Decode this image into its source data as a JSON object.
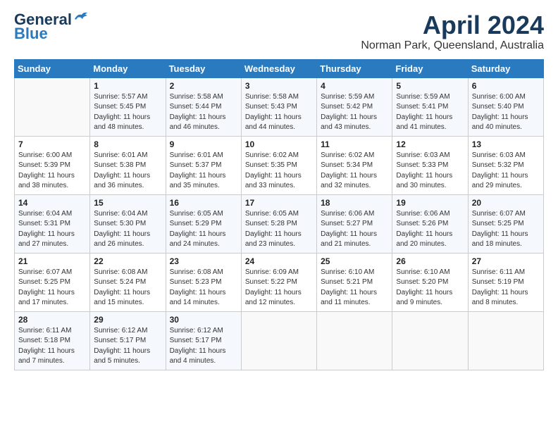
{
  "logo": {
    "line1": "General",
    "line2": "Blue"
  },
  "title": "April 2024",
  "location": "Norman Park, Queensland, Australia",
  "headers": [
    "Sunday",
    "Monday",
    "Tuesday",
    "Wednesday",
    "Thursday",
    "Friday",
    "Saturday"
  ],
  "weeks": [
    [
      {
        "day": "",
        "info": ""
      },
      {
        "day": "1",
        "info": "Sunrise: 5:57 AM\nSunset: 5:45 PM\nDaylight: 11 hours\nand 48 minutes."
      },
      {
        "day": "2",
        "info": "Sunrise: 5:58 AM\nSunset: 5:44 PM\nDaylight: 11 hours\nand 46 minutes."
      },
      {
        "day": "3",
        "info": "Sunrise: 5:58 AM\nSunset: 5:43 PM\nDaylight: 11 hours\nand 44 minutes."
      },
      {
        "day": "4",
        "info": "Sunrise: 5:59 AM\nSunset: 5:42 PM\nDaylight: 11 hours\nand 43 minutes."
      },
      {
        "day": "5",
        "info": "Sunrise: 5:59 AM\nSunset: 5:41 PM\nDaylight: 11 hours\nand 41 minutes."
      },
      {
        "day": "6",
        "info": "Sunrise: 6:00 AM\nSunset: 5:40 PM\nDaylight: 11 hours\nand 40 minutes."
      }
    ],
    [
      {
        "day": "7",
        "info": "Sunrise: 6:00 AM\nSunset: 5:39 PM\nDaylight: 11 hours\nand 38 minutes."
      },
      {
        "day": "8",
        "info": "Sunrise: 6:01 AM\nSunset: 5:38 PM\nDaylight: 11 hours\nand 36 minutes."
      },
      {
        "day": "9",
        "info": "Sunrise: 6:01 AM\nSunset: 5:37 PM\nDaylight: 11 hours\nand 35 minutes."
      },
      {
        "day": "10",
        "info": "Sunrise: 6:02 AM\nSunset: 5:35 PM\nDaylight: 11 hours\nand 33 minutes."
      },
      {
        "day": "11",
        "info": "Sunrise: 6:02 AM\nSunset: 5:34 PM\nDaylight: 11 hours\nand 32 minutes."
      },
      {
        "day": "12",
        "info": "Sunrise: 6:03 AM\nSunset: 5:33 PM\nDaylight: 11 hours\nand 30 minutes."
      },
      {
        "day": "13",
        "info": "Sunrise: 6:03 AM\nSunset: 5:32 PM\nDaylight: 11 hours\nand 29 minutes."
      }
    ],
    [
      {
        "day": "14",
        "info": "Sunrise: 6:04 AM\nSunset: 5:31 PM\nDaylight: 11 hours\nand 27 minutes."
      },
      {
        "day": "15",
        "info": "Sunrise: 6:04 AM\nSunset: 5:30 PM\nDaylight: 11 hours\nand 26 minutes."
      },
      {
        "day": "16",
        "info": "Sunrise: 6:05 AM\nSunset: 5:29 PM\nDaylight: 11 hours\nand 24 minutes."
      },
      {
        "day": "17",
        "info": "Sunrise: 6:05 AM\nSunset: 5:28 PM\nDaylight: 11 hours\nand 23 minutes."
      },
      {
        "day": "18",
        "info": "Sunrise: 6:06 AM\nSunset: 5:27 PM\nDaylight: 11 hours\nand 21 minutes."
      },
      {
        "day": "19",
        "info": "Sunrise: 6:06 AM\nSunset: 5:26 PM\nDaylight: 11 hours\nand 20 minutes."
      },
      {
        "day": "20",
        "info": "Sunrise: 6:07 AM\nSunset: 5:25 PM\nDaylight: 11 hours\nand 18 minutes."
      }
    ],
    [
      {
        "day": "21",
        "info": "Sunrise: 6:07 AM\nSunset: 5:25 PM\nDaylight: 11 hours\nand 17 minutes."
      },
      {
        "day": "22",
        "info": "Sunrise: 6:08 AM\nSunset: 5:24 PM\nDaylight: 11 hours\nand 15 minutes."
      },
      {
        "day": "23",
        "info": "Sunrise: 6:08 AM\nSunset: 5:23 PM\nDaylight: 11 hours\nand 14 minutes."
      },
      {
        "day": "24",
        "info": "Sunrise: 6:09 AM\nSunset: 5:22 PM\nDaylight: 11 hours\nand 12 minutes."
      },
      {
        "day": "25",
        "info": "Sunrise: 6:10 AM\nSunset: 5:21 PM\nDaylight: 11 hours\nand 11 minutes."
      },
      {
        "day": "26",
        "info": "Sunrise: 6:10 AM\nSunset: 5:20 PM\nDaylight: 11 hours\nand 9 minutes."
      },
      {
        "day": "27",
        "info": "Sunrise: 6:11 AM\nSunset: 5:19 PM\nDaylight: 11 hours\nand 8 minutes."
      }
    ],
    [
      {
        "day": "28",
        "info": "Sunrise: 6:11 AM\nSunset: 5:18 PM\nDaylight: 11 hours\nand 7 minutes."
      },
      {
        "day": "29",
        "info": "Sunrise: 6:12 AM\nSunset: 5:17 PM\nDaylight: 11 hours\nand 5 minutes."
      },
      {
        "day": "30",
        "info": "Sunrise: 6:12 AM\nSunset: 5:17 PM\nDaylight: 11 hours\nand 4 minutes."
      },
      {
        "day": "",
        "info": ""
      },
      {
        "day": "",
        "info": ""
      },
      {
        "day": "",
        "info": ""
      },
      {
        "day": "",
        "info": ""
      }
    ]
  ]
}
